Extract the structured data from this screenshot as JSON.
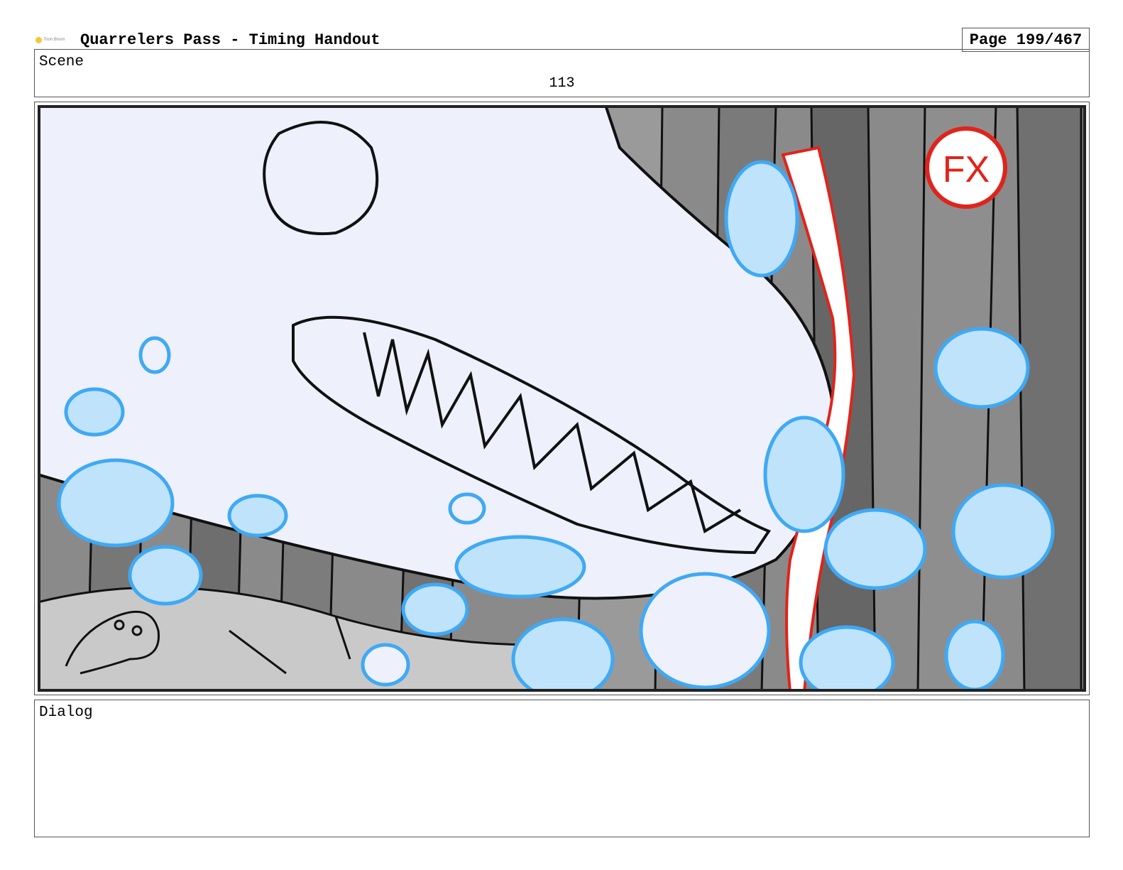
{
  "header": {
    "logo_text": "Toon Boom",
    "title": "Quarrelers Pass - Timing Handout",
    "page_indicator": "Page 199/467"
  },
  "scene": {
    "label": "Scene",
    "number": "113"
  },
  "panel": {
    "fx_badge": "FX",
    "colors": {
      "fx_red": "#e0241b",
      "smoke_blue": "#3fa9f5",
      "smoke_fill": "#bfe3fb",
      "creature_fill": "#eef0fb",
      "rock_gray": "#8a8a8a"
    }
  },
  "dialog": {
    "label": "Dialog",
    "text": ""
  }
}
